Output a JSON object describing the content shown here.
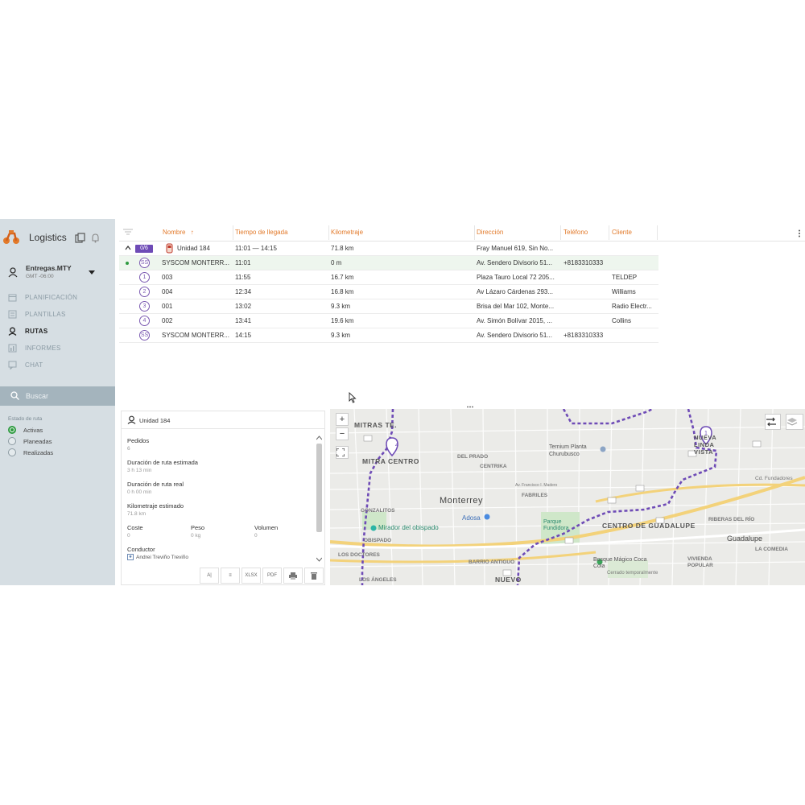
{
  "app": {
    "title": "Logistics",
    "accent": "#e27a2b",
    "route_color": "#6e4bb6"
  },
  "sidebar": {
    "org_name": "Entregas.MTY",
    "org_tz": "GMT -06:00",
    "nav": [
      {
        "label": "PLANIFICACIÓN",
        "icon": "calendar-icon",
        "active": false
      },
      {
        "label": "PLANTILLAS",
        "icon": "template-icon",
        "active": false
      },
      {
        "label": "RUTAS",
        "icon": "route-pin-icon",
        "active": true
      },
      {
        "label": "INFORMES",
        "icon": "chart-icon",
        "active": false
      },
      {
        "label": "CHAT",
        "icon": "chat-icon",
        "active": false
      }
    ],
    "search_placeholder": "Buscar",
    "filter_title": "Estado de ruta",
    "filters": [
      {
        "label": "Activas",
        "checked": true
      },
      {
        "label": "Planeadas",
        "checked": false
      },
      {
        "label": "Realizadas",
        "checked": false
      }
    ]
  },
  "grid": {
    "columns": [
      "Nombre",
      "Tiempo de llegada",
      "Kilometraje",
      "Dirección",
      "Teléfono",
      "Cliente"
    ],
    "sort_indicator": "↑",
    "route_row": {
      "badge": "0/6",
      "name": "Unidad 184",
      "time": "11:01 — 14:15",
      "km": "71.8 km",
      "address": "Fray Manuel 619, Sin No..."
    },
    "rows": [
      {
        "marker": "SS",
        "name": "SYSCOM MONTERR...",
        "time": "11:01",
        "km": "0 m",
        "address": "Av. Sendero Divisorio 51...",
        "phone": "+8183310333",
        "client": ""
      },
      {
        "marker": "1",
        "name": "003",
        "time": "11:55",
        "km": "16.7 km",
        "address": "Plaza Tauro Local 72 205...",
        "phone": "",
        "client": "TELDEP"
      },
      {
        "marker": "2",
        "name": "004",
        "time": "12:34",
        "km": "16.8 km",
        "address": "Av Lázaro Cárdenas 293...",
        "phone": "",
        "client": "Williams"
      },
      {
        "marker": "3",
        "name": "001",
        "time": "13:02",
        "km": "9.3 km",
        "address": "Brisa del Mar 102, Monte...",
        "phone": "",
        "client": "Radio Electr..."
      },
      {
        "marker": "4",
        "name": "002",
        "time": "13:41",
        "km": "19.6 km",
        "address": "Av. Simón Bolívar 2015, ...",
        "phone": "",
        "client": "Collins"
      },
      {
        "marker": "SS",
        "name": "SYSCOM MONTERR...",
        "time": "14:15",
        "km": "9.3 km",
        "address": "Av. Sendero Divisorio 51...",
        "phone": "+8183310333",
        "client": ""
      }
    ]
  },
  "details": {
    "title": "Unidad 184",
    "fields": {
      "pedidos_label": "Pedidos",
      "pedidos_value": "6",
      "dur_est_label": "Duración de ruta estimada",
      "dur_est_value": "3 h 13 min",
      "dur_real_label": "Duración de ruta real",
      "dur_real_value": "0 h 00 min",
      "km_est_label": "Kilometraje estimado",
      "km_est_value": "71.8 km",
      "coste_label": "Coste",
      "coste_value": "0",
      "peso_label": "Peso",
      "peso_value": "0 kg",
      "volumen_label": "Volumen",
      "volumen_value": "0",
      "conductor_label": "Conductor",
      "conductor_value": "Andrei Treviño Treviño"
    },
    "toolbar": [
      "A|",
      "≡",
      "XLSX",
      "PDF",
      "print",
      "delete"
    ]
  },
  "map": {
    "zoom_in": "+",
    "zoom_out": "−",
    "labels": {
      "mitras_te": "MITRAS TE.",
      "mitra_centro": "MITRA CENTRO",
      "del_prado": "DEL PRADO",
      "centrika": "CENTRIKA",
      "monterrey": "Monterrey",
      "fabriles": "FABRILES",
      "gonzalitos": "GONZALITOS",
      "mirador": "Mirador del obispado",
      "adosa": "Adosa",
      "obispado": "OBISPADO",
      "los_doctores": "LOS DOCTORES",
      "barrio_antiguo": "BARRIO ANTIGUO",
      "los_angeles": "LOS ÁNGELES",
      "nuevo": "NUEVO",
      "ternium": "Ternium Planta Churubusco",
      "parque_fundidora": "Parque Fundidora",
      "centro_guadalupe": "CENTRO DE GUADALUPE",
      "riberas": "RIBERAS DEL RÍO",
      "guadalupe": "Guadalupe",
      "la_comedia": "LA COMEDIA",
      "viviend_popular": "VIVIENDA POPULAR",
      "bosque_magico": "Bosque Mágico Coca Cola",
      "cerrado": "Cerrado temporalmente",
      "nueva_linda_vista": "NUEVA LINDA VISTA",
      "cd_fundadores": "Cd. Fundadores",
      "av_madero": "Av. Francisco I. Madero"
    },
    "markers": [
      "4",
      "1"
    ]
  }
}
